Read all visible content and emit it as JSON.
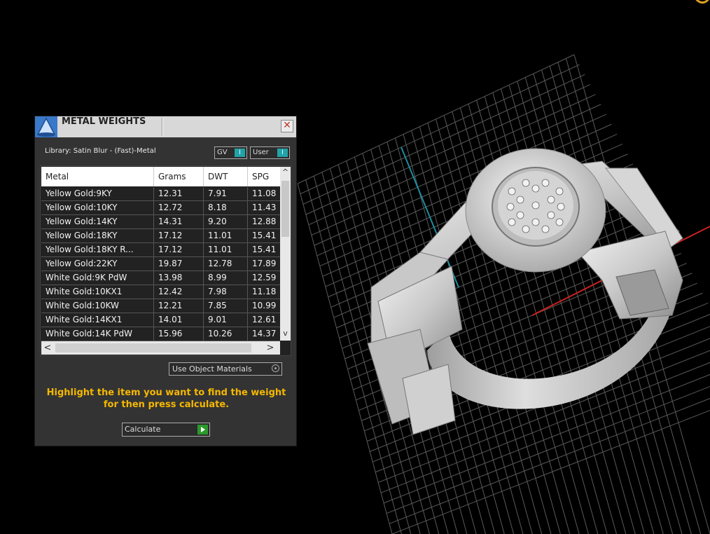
{
  "panel": {
    "title": "METAL WEIGHTS",
    "close_glyph": "✕",
    "library_label": "Library: Satin Blur - (Fast)-Metal",
    "toggles": [
      {
        "label": "GV",
        "knob": "I"
      },
      {
        "label": "User",
        "knob": "I"
      }
    ],
    "table": {
      "columns": [
        "Metal",
        "Grams",
        "DWT",
        "SPG"
      ],
      "rows": [
        [
          "Yellow Gold:9KY",
          "12.31",
          "7.91",
          "11.08"
        ],
        [
          "Yellow Gold:10KY",
          "12.72",
          "8.18",
          "11.43"
        ],
        [
          "Yellow Gold:14KY",
          "14.31",
          "9.20",
          "12.88"
        ],
        [
          "Yellow Gold:18KY",
          "17.12",
          "11.01",
          "15.41"
        ],
        [
          "Yellow Gold:18KY R...",
          "17.12",
          "11.01",
          "15.41"
        ],
        [
          "Yellow Gold:22KY",
          "19.87",
          "12.78",
          "17.89"
        ],
        [
          "White Gold:9K PdW",
          "13.98",
          "8.99",
          "12.59"
        ],
        [
          "White Gold:10KX1",
          "12.42",
          "7.98",
          "11.18"
        ],
        [
          "White Gold:10KW",
          "12.21",
          "7.85",
          "10.99"
        ],
        [
          "White Gold:14KX1",
          "14.01",
          "9.01",
          "12.61"
        ],
        [
          "White Gold:14K PdW",
          "15.96",
          "10.26",
          "14.37"
        ]
      ],
      "scroll_up": "^",
      "scroll_down": "v",
      "scroll_left": "<",
      "scroll_right": ">"
    },
    "use_object_materials": "Use Object Materials",
    "hint": "Highlight the item you want to find the weight for then press calculate.",
    "calculate_label": "Calculate"
  },
  "colors": {
    "panel_bg": "#333333",
    "accent_teal": "#22a3a8",
    "hint_yellow": "#f5b800",
    "play_green": "#2a9a2a",
    "axis_red": "#c8231e",
    "axis_cyan": "#1a8fa0"
  },
  "icons": {
    "title": "wizard-hat-icon",
    "close": "close-icon",
    "play": "play-icon"
  }
}
